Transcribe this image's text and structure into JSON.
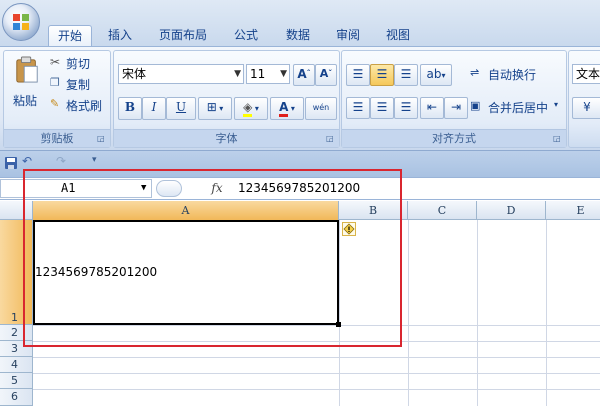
{
  "tabs": [
    "开始",
    "插入",
    "页面布局",
    "公式",
    "数据",
    "审阅",
    "视图"
  ],
  "active_tab": "开始",
  "clipboard": {
    "paste": "粘贴",
    "cut": "剪切",
    "copy": "复制",
    "format_painter": "格式刷",
    "title": "剪贴板"
  },
  "font": {
    "name": "宋体",
    "size": "11",
    "grow": "A",
    "shrink": "A",
    "bold": "B",
    "italic": "I",
    "underline": "U",
    "font_color": "A",
    "phonetic": "wén",
    "title": "字体"
  },
  "alignment": {
    "wrap_text": "自动换行",
    "merge_center": "合并后居中",
    "title": "对齐方式"
  },
  "number": {
    "format": "文本"
  },
  "formula_bar": {
    "name_box": "A1",
    "fx": "fx",
    "value": "1234569785201200"
  },
  "columns": [
    "A",
    "B",
    "C",
    "D",
    "E"
  ],
  "rows": [
    "1",
    "2",
    "3",
    "4",
    "5",
    "6"
  ],
  "cells": {
    "A1": "1234569785201200"
  },
  "colors": {
    "highlight_box": "#d9262f",
    "selected_header": "#f1b859",
    "ribbon": "#dfe8f5"
  }
}
